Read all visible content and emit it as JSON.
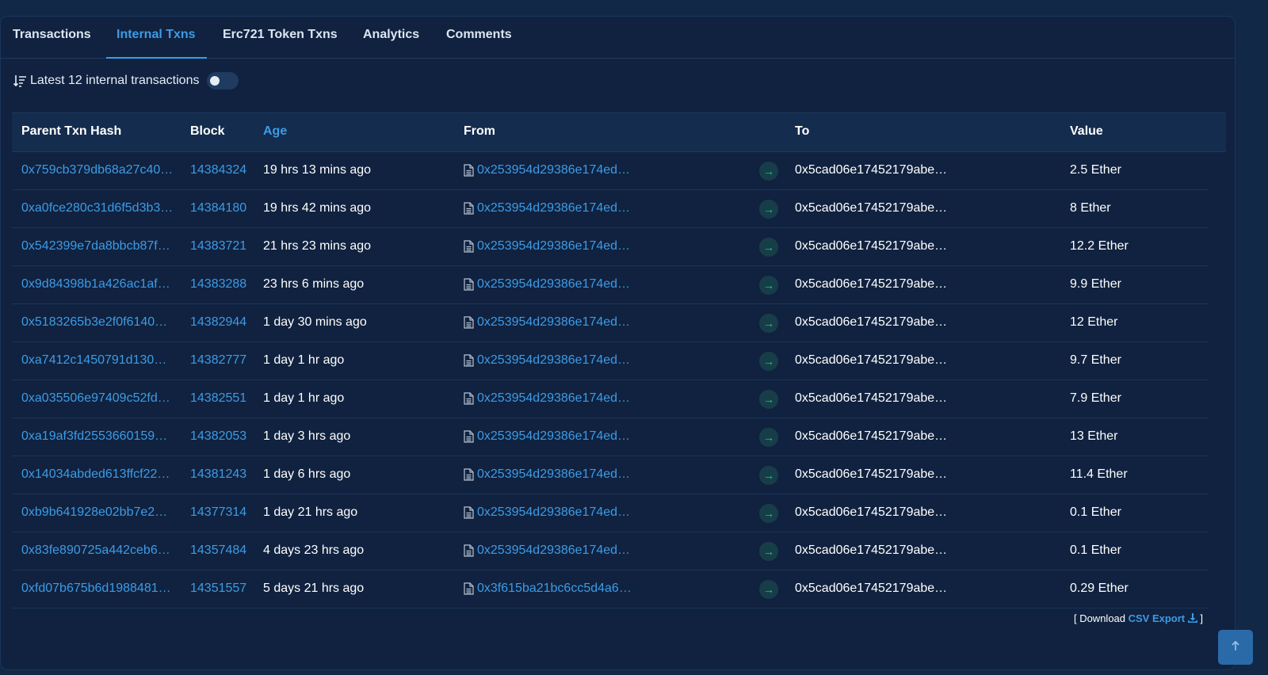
{
  "tabs": [
    {
      "label": "Transactions"
    },
    {
      "label": "Internal Txns"
    },
    {
      "label": "Erc721 Token Txns"
    },
    {
      "label": "Analytics"
    },
    {
      "label": "Comments"
    }
  ],
  "summary": {
    "text": "Latest 12 internal transactions"
  },
  "table": {
    "headers": {
      "hash": "Parent Txn Hash",
      "block": "Block",
      "age": "Age",
      "from": "From",
      "to": "To",
      "value": "Value"
    },
    "rows": [
      {
        "hash": "0x759cb379db68a27c40…",
        "block": "14384324",
        "age": "19 hrs 13 mins ago",
        "from": "0x253954d29386e174ed…",
        "to": "0x5cad06e17452179abe…",
        "value": "2.5 Ether"
      },
      {
        "hash": "0xa0fce280c31d6f5d3b3…",
        "block": "14384180",
        "age": "19 hrs 42 mins ago",
        "from": "0x253954d29386e174ed…",
        "to": "0x5cad06e17452179abe…",
        "value": "8 Ether"
      },
      {
        "hash": "0x542399e7da8bbcb87f…",
        "block": "14383721",
        "age": "21 hrs 23 mins ago",
        "from": "0x253954d29386e174ed…",
        "to": "0x5cad06e17452179abe…",
        "value": "12.2 Ether"
      },
      {
        "hash": "0x9d84398b1a426ac1af…",
        "block": "14383288",
        "age": "23 hrs 6 mins ago",
        "from": "0x253954d29386e174ed…",
        "to": "0x5cad06e17452179abe…",
        "value": "9.9 Ether"
      },
      {
        "hash": "0x5183265b3e2f0f6140e…",
        "block": "14382944",
        "age": "1 day 30 mins ago",
        "from": "0x253954d29386e174ed…",
        "to": "0x5cad06e17452179abe…",
        "value": "12 Ether"
      },
      {
        "hash": "0xa7412c1450791d1301…",
        "block": "14382777",
        "age": "1 day 1 hr ago",
        "from": "0x253954d29386e174ed…",
        "to": "0x5cad06e17452179abe…",
        "value": "9.7 Ether"
      },
      {
        "hash": "0xa035506e97409c52fd…",
        "block": "14382551",
        "age": "1 day 1 hr ago",
        "from": "0x253954d29386e174ed…",
        "to": "0x5cad06e17452179abe…",
        "value": "7.9 Ether"
      },
      {
        "hash": "0xa19af3fd25536601595…",
        "block": "14382053",
        "age": "1 day 3 hrs ago",
        "from": "0x253954d29386e174ed…",
        "to": "0x5cad06e17452179abe…",
        "value": "13 Ether"
      },
      {
        "hash": "0x14034abded613ffcf22…",
        "block": "14381243",
        "age": "1 day 6 hrs ago",
        "from": "0x253954d29386e174ed…",
        "to": "0x5cad06e17452179abe…",
        "value": "11.4 Ether"
      },
      {
        "hash": "0xb9b641928e02bb7e25…",
        "block": "14377314",
        "age": "1 day 21 hrs ago",
        "from": "0x253954d29386e174ed…",
        "to": "0x5cad06e17452179abe…",
        "value": "0.1 Ether"
      },
      {
        "hash": "0x83fe890725a442ceb6…",
        "block": "14357484",
        "age": "4 days 23 hrs ago",
        "from": "0x253954d29386e174ed…",
        "to": "0x5cad06e17452179abe…",
        "value": "0.1 Ether"
      },
      {
        "hash": "0xfd07b675b6d1988481…",
        "block": "14351557",
        "age": "5 days 21 hrs ago",
        "from": "0x3f615ba21bc6cc5d4a6…",
        "to": "0x5cad06e17452179abe…",
        "value": "0.29 Ether"
      }
    ]
  },
  "footer": {
    "open": "[ Download ",
    "link": "CSV Export",
    "close": " ]"
  },
  "colors": {
    "accent": "#3d9be6",
    "background": "#10223f",
    "arrow": "#20c997"
  },
  "icons": {
    "sort": "sort-desc-icon",
    "doc": "document-icon",
    "arrow": "arrow-right-icon",
    "download": "download-icon",
    "top": "arrow-up-icon"
  }
}
